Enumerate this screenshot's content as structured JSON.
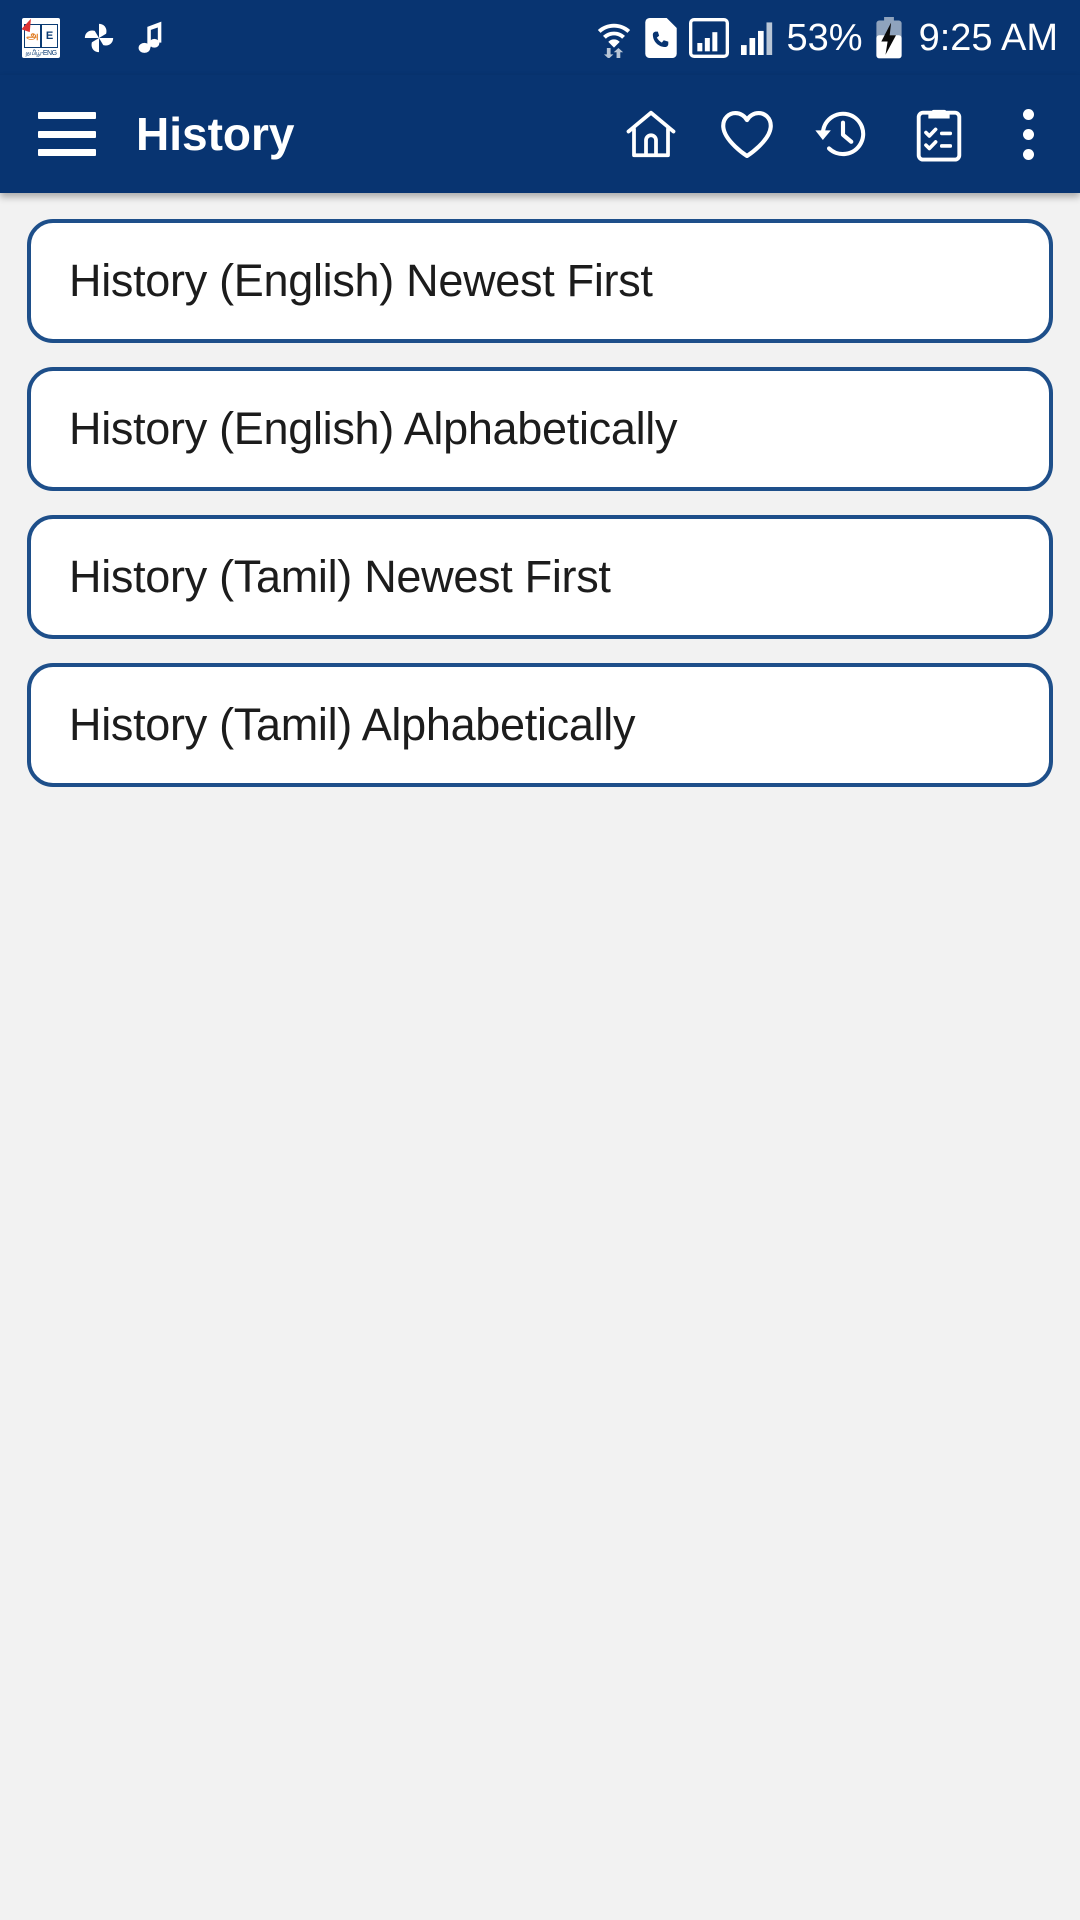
{
  "status_bar": {
    "background_color": "#083471",
    "left_icons": [
      {
        "name": "dictionary-app-icon",
        "label": "Tamil-English Dictionary",
        "glyph_left": "அ",
        "glyph_right": "E",
        "subtitle": "தமிழ்-ENG"
      },
      {
        "name": "pinwheel-icon",
        "label": "Photos"
      },
      {
        "name": "music-note-icon",
        "label": "Music"
      }
    ],
    "right_icons": [
      {
        "name": "wifi-icon",
        "label": "Wi-Fi with data transfer"
      },
      {
        "name": "sim-call-icon",
        "label": "Phone SIM"
      },
      {
        "name": "signal-boxed-icon",
        "label": "Mobile signal 1"
      },
      {
        "name": "signal-bars-icon",
        "label": "Mobile signal 2"
      }
    ],
    "battery_percent": "53%",
    "battery_state": "charging",
    "time": "9:25 AM"
  },
  "app_bar": {
    "background_color": "#083471",
    "menu_icon": "hamburger-menu-icon",
    "title": "History",
    "actions": [
      {
        "name": "home-icon",
        "label": "Home"
      },
      {
        "name": "heart-icon",
        "label": "Favorites"
      },
      {
        "name": "history-clock-icon",
        "label": "History"
      },
      {
        "name": "clipboard-checklist-icon",
        "label": "Word list"
      },
      {
        "name": "overflow-menu-icon",
        "label": "More options"
      }
    ]
  },
  "content": {
    "background_color": "#f2f2f2",
    "button_border_color": "#1e4f8a",
    "items": [
      {
        "label": "History (English) Newest First"
      },
      {
        "label": "History (English) Alphabetically"
      },
      {
        "label": "History (Tamil) Newest First"
      },
      {
        "label": "History (Tamil) Alphabetically"
      }
    ]
  }
}
